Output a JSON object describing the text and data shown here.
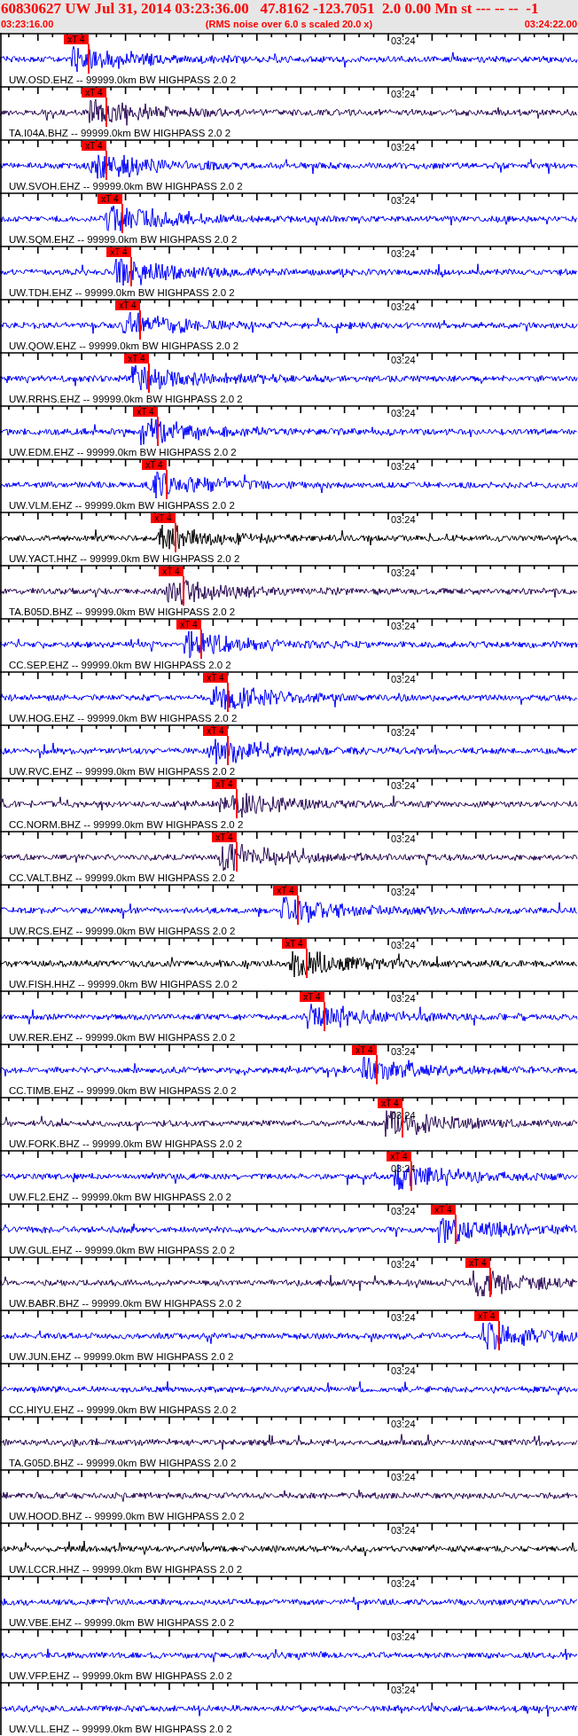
{
  "header": {
    "summary": "60830627 UW Jul 31, 2014 03:23:36.00   47.8162 -123.7051  2.0 0.00 Mn st --- -- --  -1",
    "start_time": "03:23:16.00",
    "note": "(RMS noise over 6.0 s scaled 20.0 x)",
    "end_time": "03:24:22.00"
  },
  "traces": [
    {
      "label": "UW.OSD.EHZ -- 99999.0km BW HIGHPASS 2.0 2",
      "time_mark": "03:24",
      "color": "#0000ff",
      "pick": "xT 4"
    },
    {
      "label": "TA.I04A.BHZ -- 99999.0km BW HIGHPASS 2.0 2",
      "time_mark": "03:24",
      "color": "#2b0b55",
      "pick": "xT 4"
    },
    {
      "label": "UW.SVOH.EHZ -- 99999.0km BW HIGHPASS 2.0 2",
      "time_mark": "03:24",
      "color": "#0000ff",
      "pick": "xT 4"
    },
    {
      "label": "UW.SQM.EHZ -- 99999.0km BW HIGHPASS 2.0 2",
      "time_mark": "03:24",
      "color": "#0000ff",
      "pick": "xT 4"
    },
    {
      "label": "UW.TDH.EHZ -- 99999.0km BW HIGHPASS 2.0 2",
      "time_mark": "03:24",
      "color": "#0000ff",
      "pick": "xT 4"
    },
    {
      "label": "UW.QOW.EHZ -- 99999.0km BW HIGHPASS 2.0 2",
      "time_mark": "03:24",
      "color": "#0000ff",
      "pick": "xT 4"
    },
    {
      "label": "UW.RRHS.EHZ -- 99999.0km BW HIGHPASS 2.0 2",
      "time_mark": "03:24",
      "color": "#0000ff",
      "pick": "xT 4"
    },
    {
      "label": "UW.EDM.EHZ -- 99999.0km BW HIGHPASS 2.0 2",
      "time_mark": "03:24",
      "color": "#0000ff",
      "pick": "xT 4"
    },
    {
      "label": "UW.VLM.EHZ -- 99999.0km BW HIGHPASS 2.0 2",
      "time_mark": "03:24",
      "color": "#0000ff",
      "pick": "xT 4"
    },
    {
      "label": "UW.YACT.HHZ -- 99999.0km BW HIGHPASS 2.0 2",
      "time_mark": "03:24",
      "color": "#000000",
      "pick": "xT 4"
    },
    {
      "label": "TA.B05D.BHZ -- 99999.0km BW HIGHPASS 2.0 2",
      "time_mark": "03:24",
      "color": "#2b0b55",
      "pick": "xT 4"
    },
    {
      "label": "CC.SEP.EHZ -- 99999.0km BW HIGHPASS 2.0 2",
      "time_mark": "03:24",
      "color": "#0000ff",
      "pick": "xT 4"
    },
    {
      "label": "UW.HOG.EHZ -- 99999.0km BW HIGHPASS 2.0 2",
      "time_mark": "03:24",
      "color": "#0000ff",
      "pick": "xT 4"
    },
    {
      "label": "UW.RVC.EHZ -- 99999.0km BW HIGHPASS 2.0 2",
      "time_mark": "03:24",
      "color": "#0000ff",
      "pick": "xT 4"
    },
    {
      "label": "CC.NORM.BHZ -- 99999.0km BW HIGHPASS 2.0 2",
      "time_mark": "03:24",
      "color": "#2b0b55",
      "pick": "xT 4"
    },
    {
      "label": "CC.VALT.BHZ -- 99999.0km BW HIGHPASS 2.0 2",
      "time_mark": "03:24",
      "color": "#2b0b55",
      "pick": "xT 4"
    },
    {
      "label": "UW.RCS.EHZ -- 99999.0km BW HIGHPASS 2.0 2",
      "time_mark": "03:24",
      "color": "#0000ff",
      "pick": "xT 4"
    },
    {
      "label": "UW.FISH.HHZ -- 99999.0km BW HIGHPASS 2.0 2",
      "time_mark": "03:24",
      "color": "#000000",
      "pick": "xT 4"
    },
    {
      "label": "UW.RER.EHZ -- 99999.0km BW HIGHPASS 2.0 2",
      "time_mark": "03:24",
      "color": "#0000ff",
      "pick": "xT 4"
    },
    {
      "label": "CC.TIMB.EHZ -- 99999.0km BW HIGHPASS 2.0 2",
      "time_mark": "03:24",
      "color": "#0000ff",
      "pick": "xT 4"
    },
    {
      "label": "UW.FORK.BHZ -- 99999.0km BW HIGHPASS 2.0 2",
      "time_mark": "03:24",
      "color": "#2b0b55",
      "pick": "xT 4"
    },
    {
      "label": "UW.FL2.EHZ -- 99999.0km BW HIGHPASS 2.0 2",
      "time_mark": "03:24",
      "color": "#0000ff",
      "pick": "xT 4"
    },
    {
      "label": "UW.GUL.EHZ -- 99999.0km BW HIGHPASS 2.0 2",
      "time_mark": "03:24",
      "color": "#0000ff",
      "pick": "xT 4"
    },
    {
      "label": "UW.BABR.BHZ -- 99999.0km BW HIGHPASS 2.0 2",
      "time_mark": "03:24",
      "color": "#2b0b55",
      "pick": "xT 4"
    },
    {
      "label": "UW.JUN.EHZ -- 99999.0km BW HIGHPASS 2.0 2",
      "time_mark": "03:24",
      "color": "#0000ff",
      "pick": "xT 4"
    },
    {
      "label": "CC.HIYU.EHZ -- 99999.0km BW HIGHPASS 2.0 2",
      "time_mark": "03:24",
      "color": "#0000ff"
    },
    {
      "label": "TA.G05D.BHZ -- 99999.0km BW HIGHPASS 2.0 2",
      "time_mark": "03:24",
      "color": "#2b0b55"
    },
    {
      "label": "UW.HOOD.BHZ -- 99999.0km BW HIGHPASS 2.0 2",
      "time_mark": "03:24",
      "color": "#2b0b55"
    },
    {
      "label": "UW.LCCR.HHZ -- 99999.0km BW HIGHPASS 2.0 2",
      "time_mark": "03:24",
      "color": "#000000"
    },
    {
      "label": "UW.VBE.EHZ -- 99999.0km BW HIGHPASS 2.0 2",
      "time_mark": "03:24",
      "color": "#0000ff"
    },
    {
      "label": "UW.VFP.EHZ -- 99999.0km BW HIGHPASS 2.0 2",
      "time_mark": "03:24",
      "color": "#0000ff"
    },
    {
      "label": "UW.VLL.EHZ -- 99999.0km BW HIGHPASS 2.0 2",
      "time_mark": "03:24",
      "color": "#0000ff"
    }
  ]
}
